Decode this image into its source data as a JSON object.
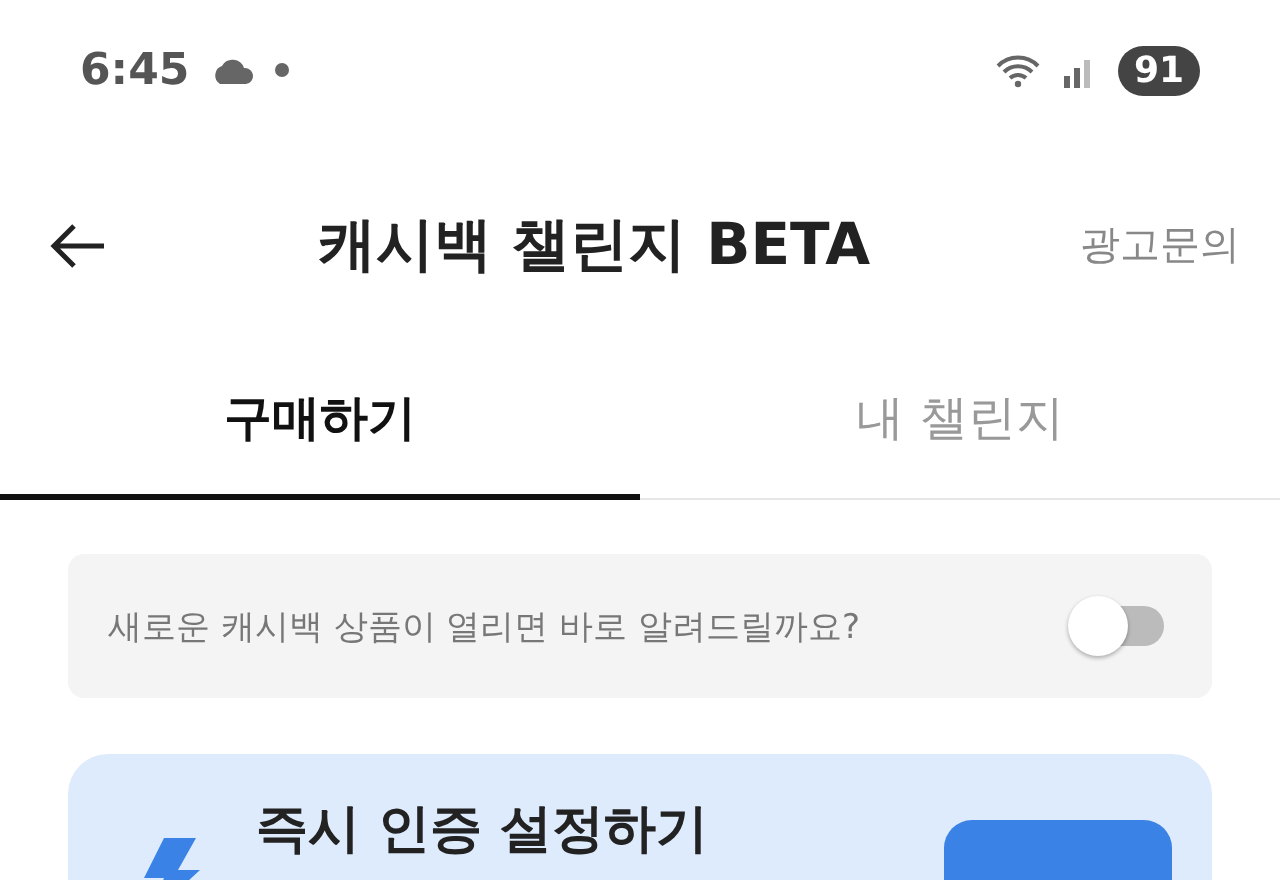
{
  "status_bar": {
    "time": "6:45",
    "battery": "91"
  },
  "header": {
    "title": "캐시백 챌린지 BETA",
    "action": "광고문의"
  },
  "tabs": [
    {
      "label": "구매하기",
      "selected": true
    },
    {
      "label": "내 챌린지",
      "selected": false
    }
  ],
  "notice": {
    "text": "새로운 캐시백 상품이 열리면 바로 알려드릴까요?",
    "on": false
  },
  "card": {
    "title": "즉시 인증 설정하기"
  }
}
